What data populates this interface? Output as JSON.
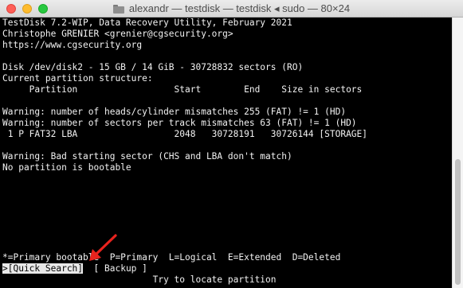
{
  "window": {
    "title": "alexandr — testdisk — testdisk ◂ sudo — 80×24",
    "folder_icon": "folder-icon"
  },
  "terminal": {
    "lines": [
      "TestDisk 7.2-WIP, Data Recovery Utility, February 2021",
      "Christophe GRENIER <grenier@cgsecurity.org>",
      "https://www.cgsecurity.org",
      "",
      "Disk /dev/disk2 - 15 GB / 14 GiB - 30728832 sectors (RO)",
      "Current partition structure:",
      "     Partition                  Start        End    Size in sectors",
      "",
      "Warning: number of heads/cylinder mismatches 255 (FAT) != 1 (HD)",
      "Warning: number of sectors per track mismatches 63 (FAT) != 1 (HD)",
      " 1 P FAT32 LBA                  2048   30728191   30726144 [STORAGE]",
      "",
      "Warning: Bad starting sector (CHS and LBA don't match)",
      "No partition is bootable"
    ],
    "legend": "*=Primary bootable  P=Primary  L=Logical  E=Extended  D=Deleted",
    "menu": {
      "selected": ">[Quick Search]",
      "gap": "  ",
      "backup": "[ Backup ]"
    },
    "hint": "                            Try to locate partition"
  },
  "colors": {
    "terminal_bg": "#000000",
    "terminal_fg": "#f2f2f2",
    "annotation_arrow": "#e8231e"
  }
}
